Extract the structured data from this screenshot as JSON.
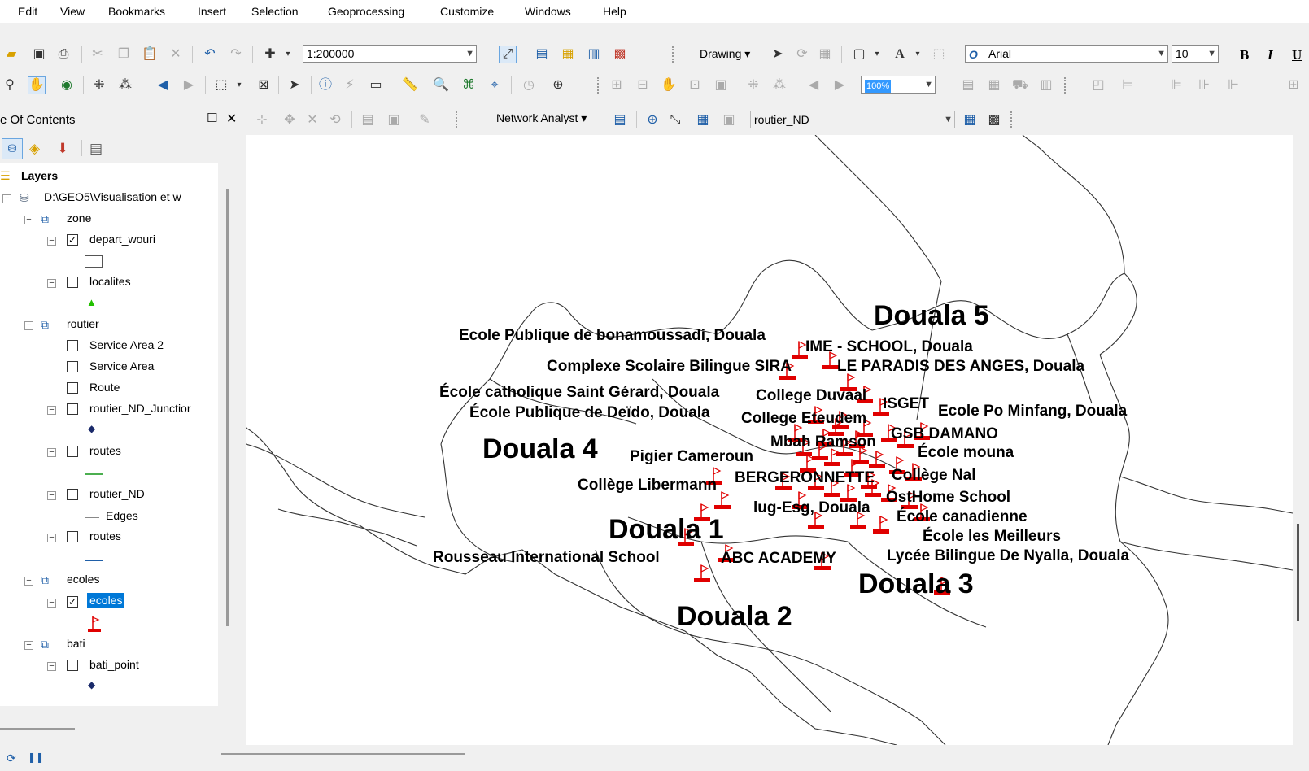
{
  "menu": [
    "Edit",
    "View",
    "Bookmarks",
    "Insert",
    "Selection",
    "Geoprocessing",
    "Customize",
    "Windows",
    "Help"
  ],
  "toolbar": {
    "scale": "1:200000",
    "drawing_label": "Drawing ▾",
    "font_name": "Arial",
    "font_size": "10",
    "bold": "B",
    "italic": "I",
    "underline": "U",
    "zoom_percent": "100%",
    "network_analyst_label": "Network Analyst ▾",
    "network_dataset": "routier_ND"
  },
  "toc": {
    "title": "e Of Contents",
    "close": "✕",
    "items": [
      {
        "label": "Layers"
      },
      {
        "label": "D:\\GEO5\\Visualisation et w"
      },
      {
        "label": "zone"
      },
      {
        "label": "depart_wouri"
      },
      {
        "label": "localites"
      },
      {
        "label": "routier"
      },
      {
        "label": "Service Area 2"
      },
      {
        "label": "Service Area"
      },
      {
        "label": "Route"
      },
      {
        "label": "routier_ND_Junctior"
      },
      {
        "label": "routes"
      },
      {
        "label": "routier_ND"
      },
      {
        "label": "Edges"
      },
      {
        "label": "routes"
      },
      {
        "label": "ecoles"
      },
      {
        "label": "ecoles"
      },
      {
        "label": "bati"
      },
      {
        "label": "bati_point"
      }
    ]
  },
  "map": {
    "districts": [
      "Douala 5",
      "Douala 4",
      "Douala 1",
      "Douala 3",
      "Douala 2"
    ],
    "schools": [
      "Ecole Publique de bonamoussadi, Douala",
      "IME - SCHOOL, Douala",
      "Complexe Scolaire Bilingue SIRA",
      "LE PARADIS DES ANGES, Douala",
      "École catholique Saint Gérard, Douala",
      "College Duvaal",
      "ISGET",
      "École Publique de Deïdo, Douala",
      "College Eteudem",
      "Ecole Po Minfang, Douala",
      "GSB DAMANO",
      "Mbah Ramson",
      "École mouna",
      "Pigier Cameroun",
      "BERGERONNETTE",
      "Collège Nal",
      "Collège Libermann",
      "OstHome School",
      "lug-Esg, Douala",
      "École canadienne",
      "École les Meilleurs",
      "Rousseau International School",
      "ABC ACADEMY",
      "Lycée Bilingue De Nyalla, Douala"
    ]
  },
  "colors": {
    "accent": "#0078d7",
    "flag": "#e00000",
    "selection": "#3399ff"
  }
}
